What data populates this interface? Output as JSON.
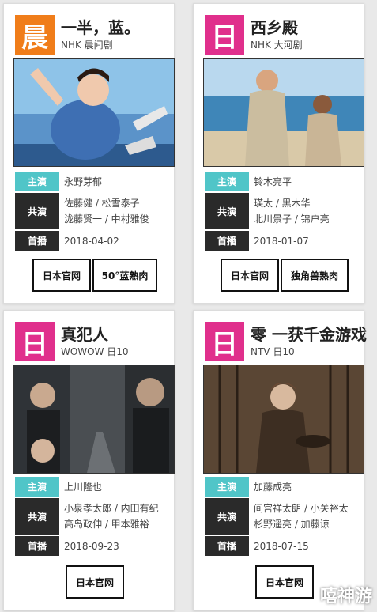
{
  "cards": [
    {
      "badge": "晨",
      "badge_color": "#f07d1a",
      "title": "一半，蓝。",
      "subtitle": "NHK 晨间剧",
      "leads_label": "主演",
      "leads": "永野芽郁",
      "cast_label": "共演",
      "cast_line1": "佐藤健 / 松雪泰子",
      "cast_line2": "泷藤贤一 / 中村雅俊",
      "premiere_label": "首播",
      "premiere": "2018-04-02",
      "buttons": [
        "日本官网",
        "50°蓝熟肉"
      ]
    },
    {
      "badge": "日",
      "badge_color": "#e02f8c",
      "title": "西乡殿",
      "subtitle": "NHK 大河剧",
      "leads_label": "主演",
      "leads": "铃木亮平",
      "cast_label": "共演",
      "cast_line1": "瑛太 / 黑木华",
      "cast_line2": "北川景子 / 锦户亮",
      "premiere_label": "首播",
      "premiere": "2018-01-07",
      "buttons": [
        "日本官网",
        "独角兽熟肉"
      ]
    },
    {
      "badge": "日",
      "badge_color": "#e02f8c",
      "title": "真犯人",
      "subtitle": "WOWOW 日10",
      "leads_label": "主演",
      "leads": "上川隆也",
      "cast_label": "共演",
      "cast_line1": "小泉孝太郎 / 内田有纪",
      "cast_line2": "高岛政伸 / 甲本雅裕",
      "premiere_label": "首播",
      "premiere": "2018-09-23",
      "buttons": [
        "日本官网"
      ]
    },
    {
      "badge": "日",
      "badge_color": "#e02f8c",
      "title": "零 一获千金游戏",
      "subtitle": "NTV 日10",
      "leads_label": "主演",
      "leads": "加藤成亮",
      "cast_label": "共演",
      "cast_line1": "间宫祥太朗 / 小关裕太",
      "cast_line2": "杉野遥亮 / 加藤谅",
      "premiere_label": "首播",
      "premiere": "2018-07-15",
      "buttons": [
        "日本官网"
      ]
    }
  ],
  "watermark": "嘻神游"
}
